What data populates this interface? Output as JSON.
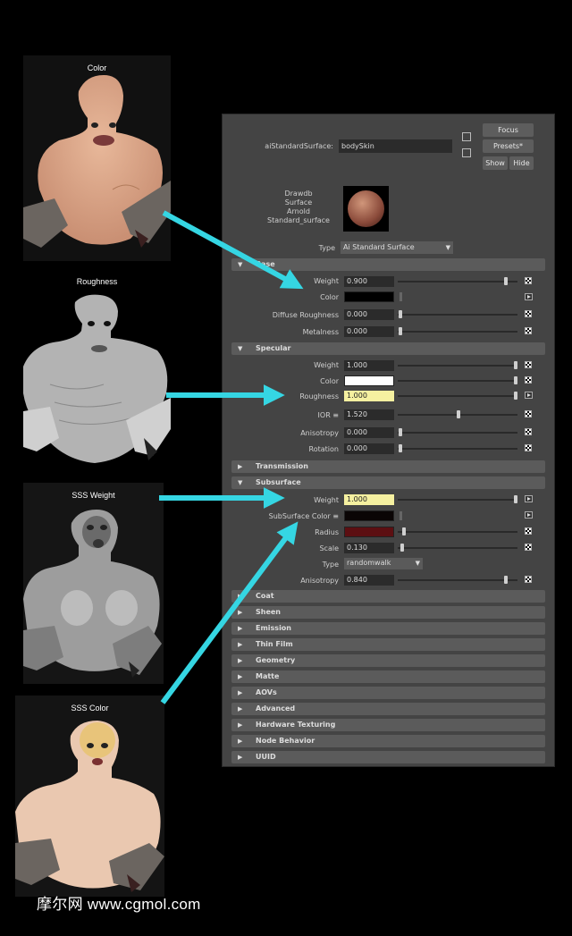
{
  "textures": [
    {
      "title": "Color"
    },
    {
      "title": "Roughness"
    },
    {
      "title": "SSS Weight"
    },
    {
      "title": "SSS Color"
    }
  ],
  "editor": {
    "node_type_label": "aiStandardSurface:",
    "node_name": "bodySkin",
    "buttons": {
      "focus": "Focus",
      "presets": "Presets*",
      "show": "Show",
      "hide": "Hide"
    },
    "swatch_caption": [
      "Drawdb",
      "Surface",
      "Arnold",
      "Standard_surface"
    ],
    "type_label": "Type",
    "type_value": "Ai Standard Surface",
    "base": {
      "title": "Base",
      "weight_label": "Weight",
      "weight_value": "0.900",
      "weight_level": 0.9,
      "color_label": "Color",
      "color": "#000000",
      "diffuse_roughness_label": "Diffuse Roughness",
      "diffuse_roughness_value": "0.000",
      "metalness_label": "Metalness",
      "metalness_value": "0.000"
    },
    "specular": {
      "title": "Specular",
      "weight_label": "Weight",
      "weight_value": "1.000",
      "color_label": "Color",
      "color": "#ffffff",
      "roughness_label": "Roughness",
      "roughness_value": "1.000",
      "ior_label": "IOR ≡",
      "ior_value": "1.520",
      "anisotropy_label": "Anisotropy",
      "anisotropy_value": "0.000",
      "rotation_label": "Rotation",
      "rotation_value": "0.000"
    },
    "transmission_title": "Transmission",
    "subsurface": {
      "title": "Subsurface",
      "weight_label": "Weight",
      "weight_value": "1.000",
      "color_label": "SubSurface Color ≡",
      "color": "#0a0505",
      "radius_label": "Radius",
      "radius_color": "#5c0f12",
      "scale_label": "Scale",
      "scale_value": "0.130",
      "type_label": "Type",
      "type_value": "randomwalk",
      "anisotropy_label": "Anisotropy",
      "anisotropy_value": "0.840"
    },
    "collapsed_sections": [
      "Coat",
      "Sheen",
      "Emission",
      "Thin Film",
      "Geometry",
      "Matte",
      "AOVs",
      "Advanced",
      "Hardware Texturing",
      "Node Behavior",
      "UUID"
    ]
  },
  "colors": {
    "arrow": "#35d6e3",
    "panel_bg": "#444444",
    "highlight_field": "#f5f0a0"
  },
  "watermark": "摩尔网 www.cgmol.com"
}
